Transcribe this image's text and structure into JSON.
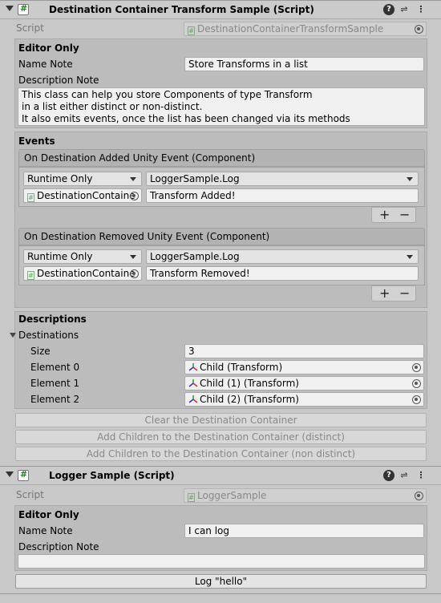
{
  "component1": {
    "title": "Destination Container Transform Sample (Script)",
    "script_label": "Script",
    "script_value": "DestinationContainerTransformSample",
    "editor_only_header": "Editor Only",
    "name_note_label": "Name Note",
    "name_note_value": "Store Transforms in a list",
    "description_note_label": "Description Note",
    "description_lines": [
      "This class can help you store Components of type Transform",
      "in a list either distinct or non-distinct.",
      "It also emits events, once the list has been changed via its methods"
    ],
    "events_header": "Events",
    "event_added": {
      "title": "On Destination Added Unity Event (Component)",
      "mode": "Runtime Only",
      "function": "LoggerSample.Log",
      "target": "DestinationContaine",
      "argument": "Transform Added!"
    },
    "event_removed": {
      "title": "On Destination Removed Unity Event (Component)",
      "mode": "Runtime Only",
      "function": "LoggerSample.Log",
      "target": "DestinationContaine",
      "argument": "Transform Removed!"
    },
    "plus": "+",
    "minus": "−",
    "descriptions_header": "Descriptions",
    "destinations_label": "Destinations",
    "size_label": "Size",
    "size_value": "3",
    "elements": [
      {
        "label": "Element 0",
        "value": "Child (Transform)"
      },
      {
        "label": "Element 1",
        "value": "Child (1) (Transform)"
      },
      {
        "label": "Element 2",
        "value": "Child (2) (Transform)"
      }
    ],
    "buttons": {
      "clear": "Clear the Destination Container",
      "add_distinct": "Add Children to the Destination Container (distinct)",
      "add_non_distinct": "Add Children to the Destination Container (non distinct)"
    }
  },
  "component2": {
    "title": "Logger Sample (Script)",
    "script_label": "Script",
    "script_value": "LoggerSample",
    "editor_only_header": "Editor Only",
    "name_note_label": "Name Note",
    "name_note_value": "I can log",
    "description_note_label": "Description Note",
    "description_value": "",
    "log_button": "Log \"hello\""
  },
  "header_icons": [
    "help-icon",
    "presets-icon",
    "menu-icon"
  ]
}
